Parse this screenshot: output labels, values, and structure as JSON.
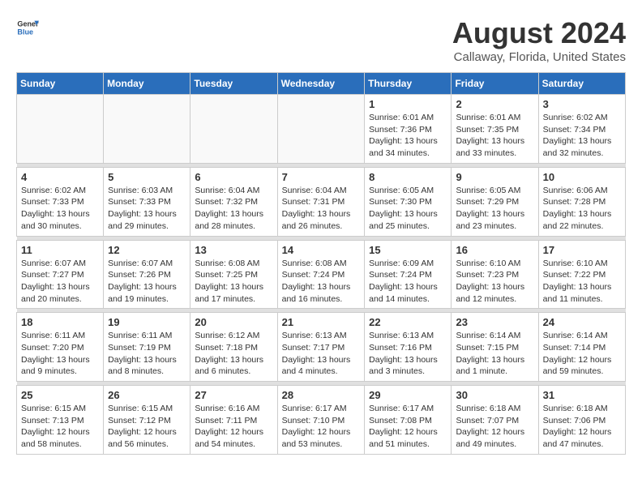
{
  "header": {
    "logo_line1": "General",
    "logo_line2": "Blue",
    "month": "August 2024",
    "location": "Callaway, Florida, United States"
  },
  "days_of_week": [
    "Sunday",
    "Monday",
    "Tuesday",
    "Wednesday",
    "Thursday",
    "Friday",
    "Saturday"
  ],
  "weeks": [
    {
      "days": [
        {
          "num": "",
          "empty": true
        },
        {
          "num": "",
          "empty": true
        },
        {
          "num": "",
          "empty": true
        },
        {
          "num": "",
          "empty": true
        },
        {
          "num": "1",
          "rise": "6:01 AM",
          "set": "7:36 PM",
          "daylight": "13 hours and 34 minutes."
        },
        {
          "num": "2",
          "rise": "6:01 AM",
          "set": "7:35 PM",
          "daylight": "13 hours and 33 minutes."
        },
        {
          "num": "3",
          "rise": "6:02 AM",
          "set": "7:34 PM",
          "daylight": "13 hours and 32 minutes."
        }
      ]
    },
    {
      "days": [
        {
          "num": "4",
          "rise": "6:02 AM",
          "set": "7:33 PM",
          "daylight": "13 hours and 30 minutes."
        },
        {
          "num": "5",
          "rise": "6:03 AM",
          "set": "7:33 PM",
          "daylight": "13 hours and 29 minutes."
        },
        {
          "num": "6",
          "rise": "6:04 AM",
          "set": "7:32 PM",
          "daylight": "13 hours and 28 minutes."
        },
        {
          "num": "7",
          "rise": "6:04 AM",
          "set": "7:31 PM",
          "daylight": "13 hours and 26 minutes."
        },
        {
          "num": "8",
          "rise": "6:05 AM",
          "set": "7:30 PM",
          "daylight": "13 hours and 25 minutes."
        },
        {
          "num": "9",
          "rise": "6:05 AM",
          "set": "7:29 PM",
          "daylight": "13 hours and 23 minutes."
        },
        {
          "num": "10",
          "rise": "6:06 AM",
          "set": "7:28 PM",
          "daylight": "13 hours and 22 minutes."
        }
      ]
    },
    {
      "days": [
        {
          "num": "11",
          "rise": "6:07 AM",
          "set": "7:27 PM",
          "daylight": "13 hours and 20 minutes."
        },
        {
          "num": "12",
          "rise": "6:07 AM",
          "set": "7:26 PM",
          "daylight": "13 hours and 19 minutes."
        },
        {
          "num": "13",
          "rise": "6:08 AM",
          "set": "7:25 PM",
          "daylight": "13 hours and 17 minutes."
        },
        {
          "num": "14",
          "rise": "6:08 AM",
          "set": "7:24 PM",
          "daylight": "13 hours and 16 minutes."
        },
        {
          "num": "15",
          "rise": "6:09 AM",
          "set": "7:24 PM",
          "daylight": "13 hours and 14 minutes."
        },
        {
          "num": "16",
          "rise": "6:10 AM",
          "set": "7:23 PM",
          "daylight": "13 hours and 12 minutes."
        },
        {
          "num": "17",
          "rise": "6:10 AM",
          "set": "7:22 PM",
          "daylight": "13 hours and 11 minutes."
        }
      ]
    },
    {
      "days": [
        {
          "num": "18",
          "rise": "6:11 AM",
          "set": "7:20 PM",
          "daylight": "13 hours and 9 minutes."
        },
        {
          "num": "19",
          "rise": "6:11 AM",
          "set": "7:19 PM",
          "daylight": "13 hours and 8 minutes."
        },
        {
          "num": "20",
          "rise": "6:12 AM",
          "set": "7:18 PM",
          "daylight": "13 hours and 6 minutes."
        },
        {
          "num": "21",
          "rise": "6:13 AM",
          "set": "7:17 PM",
          "daylight": "13 hours and 4 minutes."
        },
        {
          "num": "22",
          "rise": "6:13 AM",
          "set": "7:16 PM",
          "daylight": "13 hours and 3 minutes."
        },
        {
          "num": "23",
          "rise": "6:14 AM",
          "set": "7:15 PM",
          "daylight": "13 hours and 1 minute."
        },
        {
          "num": "24",
          "rise": "6:14 AM",
          "set": "7:14 PM",
          "daylight": "12 hours and 59 minutes."
        }
      ]
    },
    {
      "days": [
        {
          "num": "25",
          "rise": "6:15 AM",
          "set": "7:13 PM",
          "daylight": "12 hours and 58 minutes."
        },
        {
          "num": "26",
          "rise": "6:15 AM",
          "set": "7:12 PM",
          "daylight": "12 hours and 56 minutes."
        },
        {
          "num": "27",
          "rise": "6:16 AM",
          "set": "7:11 PM",
          "daylight": "12 hours and 54 minutes."
        },
        {
          "num": "28",
          "rise": "6:17 AM",
          "set": "7:10 PM",
          "daylight": "12 hours and 53 minutes."
        },
        {
          "num": "29",
          "rise": "6:17 AM",
          "set": "7:08 PM",
          "daylight": "12 hours and 51 minutes."
        },
        {
          "num": "30",
          "rise": "6:18 AM",
          "set": "7:07 PM",
          "daylight": "12 hours and 49 minutes."
        },
        {
          "num": "31",
          "rise": "6:18 AM",
          "set": "7:06 PM",
          "daylight": "12 hours and 47 minutes."
        }
      ]
    }
  ],
  "labels": {
    "sunrise": "Sunrise:",
    "sunset": "Sunset:",
    "daylight": "Daylight:"
  }
}
